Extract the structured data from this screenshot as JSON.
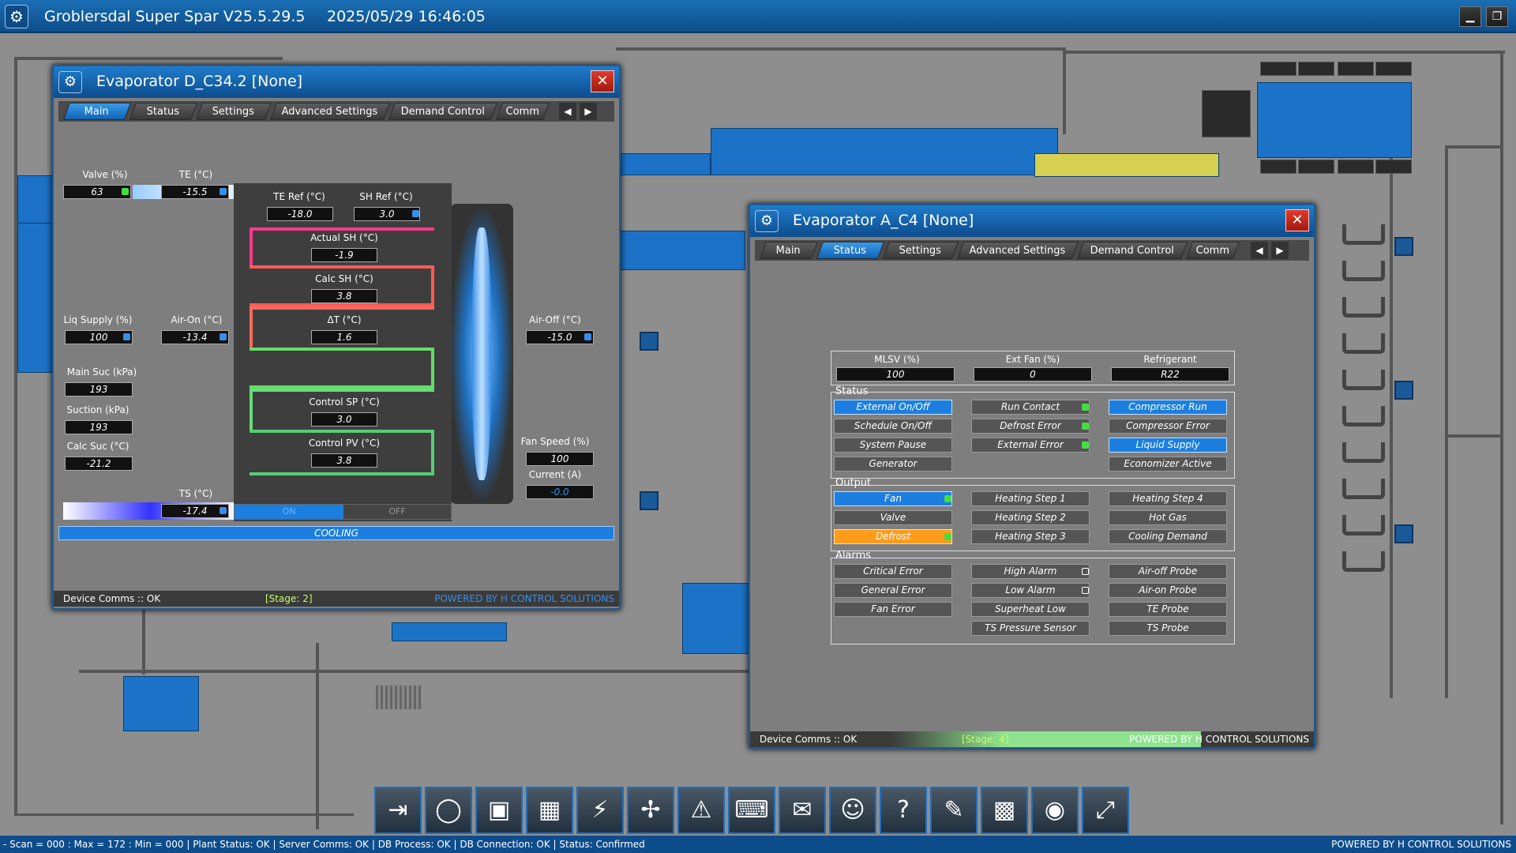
{
  "app": {
    "title": "Groblersdal Super Spar V25.5.29.5",
    "datetime": "2025/05/29 16:46:05"
  },
  "window_d": {
    "title": "Evaporator D_C34.2 [None]",
    "tabs": [
      "Main",
      "Status",
      "Settings",
      "Advanced Settings",
      "Demand Control",
      "Comm"
    ],
    "active_tab": "Main",
    "fields": {
      "valve_label": "Valve (%)",
      "valve": "63",
      "te_label": "TE (°C)",
      "te": "-15.5",
      "te_ref_label": "TE Ref (°C)",
      "te_ref": "-18.0",
      "sh_ref_label": "SH Ref (°C)",
      "sh_ref": "3.0",
      "actual_sh_label": "Actual SH (°C)",
      "actual_sh": "-1.9",
      "calc_sh_label": "Calc SH (°C)",
      "calc_sh": "3.8",
      "dt_label": "ΔT (°C)",
      "dt": "1.6",
      "control_sp_label": "Control SP (°C)",
      "control_sp": "3.0",
      "control_pv_label": "Control PV (°C)",
      "control_pv": "3.8",
      "liq_supply_label": "Liq Supply (%)",
      "liq_supply": "100",
      "air_on_label": "Air-On (°C)",
      "air_on": "-13.4",
      "air_off_label": "Air-Off (°C)",
      "air_off": "-15.0",
      "main_suc_label": "Main Suc (kPa)",
      "main_suc": "193",
      "suction_label": "Suction (kPa)",
      "suction": "193",
      "calc_suc_label": "Calc Suc (°C)",
      "calc_suc": "-21.2",
      "ts_label": "TS (°C)",
      "ts": "-17.4",
      "fan_speed_label": "Fan Speed (%)",
      "fan_speed": "100",
      "current_label": "Current (A)",
      "current": "-0.0"
    },
    "toggle_on": "ON",
    "toggle_off": "OFF",
    "mode": "COOLING",
    "status_left": "Device Comms :: OK",
    "status_mid": "[Stage: 2]",
    "status_right": "POWERED BY H CONTROL SOLUTIONS"
  },
  "window_a": {
    "title": "Evaporator A_C4 [None]",
    "tabs": [
      "Main",
      "Status",
      "Settings",
      "Advanced Settings",
      "Demand Control",
      "Comm"
    ],
    "active_tab": "Status",
    "top": {
      "mlsv_label": "MLSV (%)",
      "mlsv": "100",
      "extfan_label": "Ext Fan (%)",
      "extfan": "0",
      "refrigerant_label": "Refrigerant",
      "refrigerant": "R22"
    },
    "status_label": "Status",
    "status_buttons": [
      {
        "label": "External On/Off",
        "on": true
      },
      {
        "label": "Run Contact",
        "on": false,
        "led": "green"
      },
      {
        "label": "Compressor Run",
        "on": true
      },
      {
        "label": "Schedule On/Off",
        "on": false
      },
      {
        "label": "Defrost Error",
        "on": false,
        "led": "green"
      },
      {
        "label": "Compressor Error",
        "on": false
      },
      {
        "label": "System Pause",
        "on": false
      },
      {
        "label": "External Error",
        "on": false,
        "led": "green"
      },
      {
        "label": "Liquid Supply",
        "on": true
      },
      {
        "label": "Generator",
        "on": false
      },
      {
        "label": "Economizer Active",
        "on": false
      }
    ],
    "output_label": "Output",
    "output_buttons": [
      {
        "label": "Fan",
        "on": true,
        "led": "green"
      },
      {
        "label": "Heating Step 1",
        "on": false
      },
      {
        "label": "Heating Step 4",
        "on": false
      },
      {
        "label": "Valve",
        "on": false
      },
      {
        "label": "Heating Step 2",
        "on": false
      },
      {
        "label": "Hot Gas",
        "on": false
      },
      {
        "label": "Defrost",
        "orange": true,
        "led": "green"
      },
      {
        "label": "Heating Step 3",
        "on": false
      },
      {
        "label": "Cooling Demand",
        "on": false
      }
    ],
    "alarms_label": "Alarms",
    "alarm_buttons": [
      {
        "label": "Critical Error"
      },
      {
        "label": "High Alarm",
        "led": "white"
      },
      {
        "label": "Air-off Probe"
      },
      {
        "label": "General Error"
      },
      {
        "label": "Low Alarm",
        "led": "white"
      },
      {
        "label": "Air-on Probe"
      },
      {
        "label": "Fan Error"
      },
      {
        "label": "Superheat Low"
      },
      {
        "label": "TE Probe"
      },
      {
        "label": "TS Pressure Sensor"
      },
      {
        "label": "TS Probe"
      }
    ],
    "status_left": "Device Comms :: OK",
    "status_mid": "[Stage: 4]",
    "status_right": "POWERED BY H CONTROL SOLUTIONS"
  },
  "toolbar": [
    "login-icon",
    "refresh-icon",
    "save-icon",
    "calendar-icon",
    "power-icon",
    "fan-icon",
    "alarm-icon",
    "keyboard-icon",
    "mail-icon",
    "user-settings-icon",
    "help-icon",
    "tools-icon",
    "qr-code-icon",
    "view-icon",
    "fullscreen-icon"
  ],
  "bottombar": {
    "left": "- Scan = 000 : Max = 172 : Min = 000  |  Plant Status: OK  |  Server Comms: OK  |  DB Process: OK  |  DB Connection:  OK  |  Status: Confirmed",
    "right": "POWERED BY H CONTROL SOLUTIONS"
  },
  "colors": {
    "accent_blue": "#1c7fe0",
    "alarm_orange": "#ff9c1a",
    "ok_green": "#44dd44"
  }
}
